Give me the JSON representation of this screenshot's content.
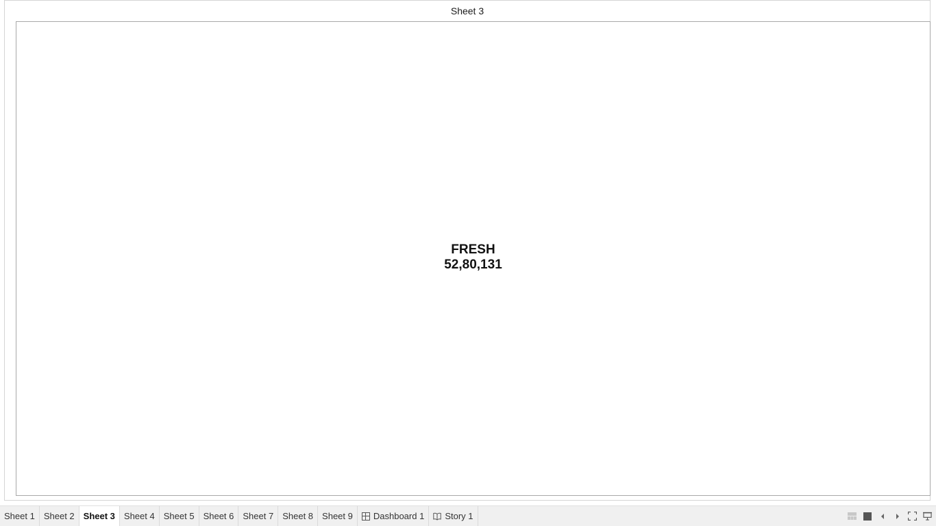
{
  "sheet": {
    "title": "Sheet 3",
    "mark_label": "FRESH",
    "mark_value": "52,80,131"
  },
  "tabs": [
    {
      "label": "Sheet 1",
      "active": false
    },
    {
      "label": "Sheet 2",
      "active": false
    },
    {
      "label": "Sheet 3",
      "active": true
    },
    {
      "label": "Sheet 4",
      "active": false
    },
    {
      "label": "Sheet 5",
      "active": false
    },
    {
      "label": "Sheet 6",
      "active": false
    },
    {
      "label": "Sheet 7",
      "active": false
    },
    {
      "label": "Sheet 8",
      "active": false
    },
    {
      "label": "Sheet 9",
      "active": false
    },
    {
      "label": "Dashboard 1",
      "active": false,
      "icon": "dashboard-icon"
    },
    {
      "label": "Story 1",
      "active": false,
      "icon": "story-icon"
    }
  ],
  "controls": [
    "show-filmstrip-icon",
    "show-tabs-icon",
    "previous-sheet-icon",
    "next-sheet-icon",
    "fullscreen-icon",
    "presentation-mode-icon"
  ],
  "colors": {
    "background": "#ffffff",
    "tabbar": "#f0f0f0",
    "active_tab": "#ffffff",
    "text": "#111111"
  }
}
